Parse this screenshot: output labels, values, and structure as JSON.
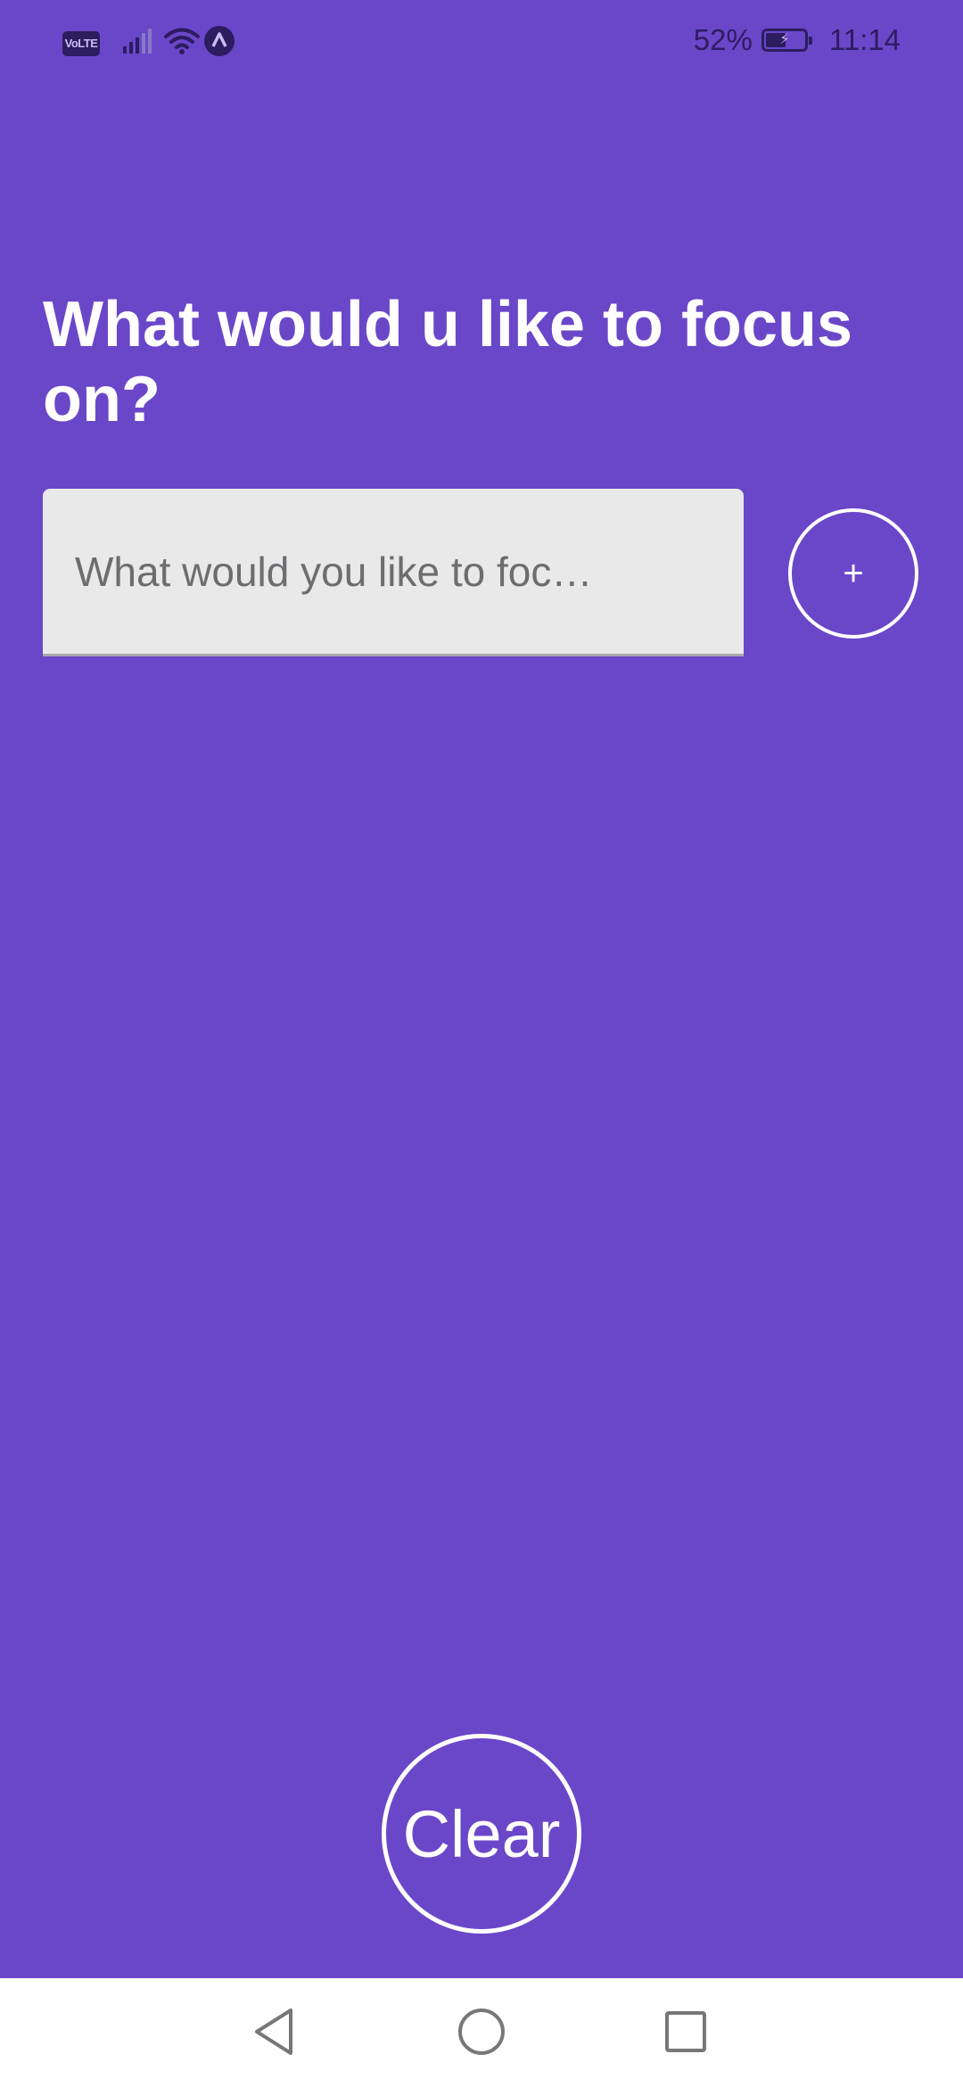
{
  "status_bar": {
    "volte": "VoLTE",
    "battery_percent": "52%",
    "battery_level": 0.52,
    "time": "11:14",
    "icons": [
      "volte-icon",
      "signal-icon",
      "wifi-icon",
      "nav-app-icon",
      "battery-charging-icon"
    ]
  },
  "main": {
    "title": "What would u like to focus on?",
    "input": {
      "placeholder": "What would you like to foc…",
      "value": ""
    },
    "add_label": "+",
    "clear_label": "Clear"
  },
  "nav": {
    "icons": [
      "back-icon",
      "home-icon",
      "recents-icon"
    ]
  },
  "colors": {
    "background": "#6a47c9",
    "input_bg": "#e9e9ea",
    "text_on_primary": "#ffffff",
    "status_text": "#2c1c60",
    "nav_bg": "#ffffff"
  }
}
